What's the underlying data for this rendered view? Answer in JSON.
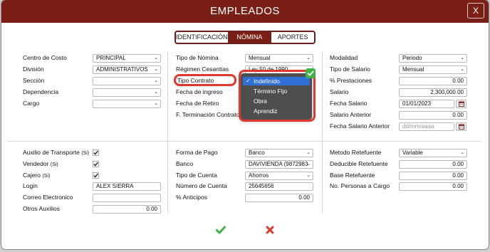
{
  "window": {
    "title": "EMPLEADOS",
    "close_label": "X"
  },
  "tabs": [
    {
      "label": "IDENTIFICACIÓN",
      "active": false
    },
    {
      "label": "NÓMINA",
      "active": true
    },
    {
      "label": "APORTES",
      "active": false
    }
  ],
  "left_top": {
    "centro_costo": {
      "label": "Centro de Costo",
      "value": "PRINCIPAL"
    },
    "division": {
      "label": "División",
      "value": "ADMINISTRATIVOS"
    },
    "seccion": {
      "label": "Sección",
      "value": ""
    },
    "dependencia": {
      "label": "Dependencia",
      "value": ""
    },
    "cargo": {
      "label": "Cargo",
      "value": ""
    }
  },
  "mid_top": {
    "tipo_nomina": {
      "label": "Tipo de Nómina",
      "value": "Mensual"
    },
    "regimen_cesantias": {
      "label": "Régimen Cesantias",
      "value": "Ley 50 de 1990"
    },
    "tipo_contrato": {
      "label": "Tipo Contrato"
    },
    "fecha_ingreso": {
      "label": "Fecha de ingreso"
    },
    "fecha_retiro": {
      "label": "Fecha de Retiro"
    },
    "fecha_terminacion": {
      "label": "F. Terminación Contrato"
    },
    "contrato_options": [
      "Indefinido",
      "Término Fijo",
      "Obra",
      "Aprendiz"
    ],
    "contrato_selected": "Indefinido"
  },
  "right_top": {
    "modalidad": {
      "label": "Modalidad",
      "value": "Periodo"
    },
    "tipo_salario": {
      "label": "Tipo de Salario",
      "value": "Mensual"
    },
    "prestaciones": {
      "label": "% Prestaciones",
      "value": "0.00"
    },
    "salario": {
      "label": "Salario",
      "value": "2,300,000.00"
    },
    "fecha_salario": {
      "label": "Fecha Salario",
      "value": "01/01/2023"
    },
    "salario_anterior": {
      "label": "Salario Anterior",
      "value": "0.00"
    },
    "fecha_salario_anterior": {
      "label": "Fecha Salario Anterior",
      "placeholder": "dd/mm/aaaa"
    }
  },
  "left_bottom": {
    "auxilio_transporte": {
      "label": "Auxilio de Transporte",
      "suffix": "(Si)",
      "checked": true
    },
    "vendedor": {
      "label": "Vendedor",
      "suffix": "(Si)",
      "checked": true
    },
    "cajero": {
      "label": "Cajero",
      "suffix": "(Si)",
      "checked": true
    },
    "login": {
      "label": "Login",
      "value": "ALEX SIERRA"
    },
    "correo": {
      "label": "Correo Electronico",
      "value": ""
    },
    "otros_auxilios": {
      "label": "Otros Auxilios",
      "value": "0.00"
    }
  },
  "mid_bottom": {
    "forma_pago": {
      "label": "Forma de Pago",
      "value": "Banco"
    },
    "banco": {
      "label": "Banco",
      "value": "DAVIVIENDA (9872983"
    },
    "tipo_cuenta": {
      "label": "Tipo de Cuenta",
      "value": "Ahorros"
    },
    "numero_cuenta": {
      "label": "Número de Cuenta",
      "value": "25645656"
    },
    "anticipos": {
      "label": "% Anticipos",
      "value": "0.00"
    }
  },
  "right_bottom": {
    "metodo_retefuente": {
      "label": "Metodo Retefuente",
      "value": "Variable"
    },
    "deducible_retefuente": {
      "label": "Deducible Retefuente",
      "value": "0.00"
    },
    "base_retefuente": {
      "label": "Base Retefuente",
      "value": "0.00"
    },
    "personas_cargo": {
      "label": "No. Personas a Cargo",
      "value": "0.00"
    }
  },
  "colors": {
    "title_bar": "#7a1f16",
    "accept": "#3fb24a",
    "cancel": "#d8392f",
    "highlight": "#e0372f",
    "dropdown_selected": "#2f6fd6"
  },
  "icons": {
    "accept": "check-icon",
    "cancel": "x-icon",
    "calendar": "calendar-icon"
  }
}
